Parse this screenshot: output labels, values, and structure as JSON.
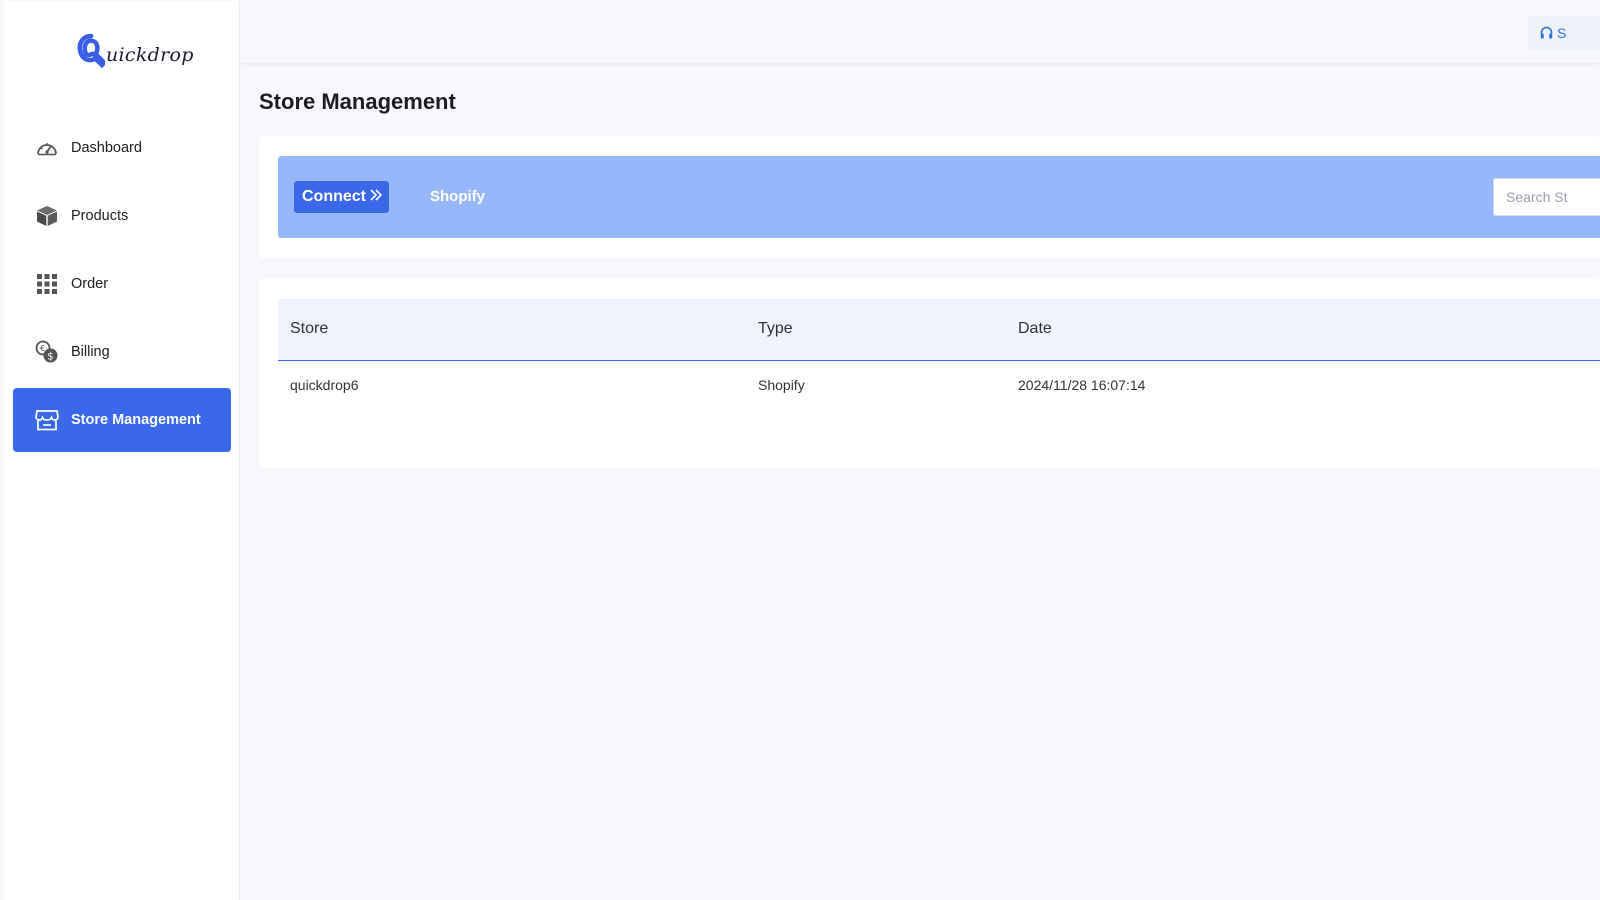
{
  "brand": {
    "logo_text": "uickdrop"
  },
  "sidebar": {
    "items": [
      {
        "label": "Dashboard",
        "icon": "dashboard-gauge-icon",
        "active": false
      },
      {
        "label": "Products",
        "icon": "box-icon",
        "active": false
      },
      {
        "label": "Order",
        "icon": "grid-icon",
        "active": false
      },
      {
        "label": "Billing",
        "icon": "coins-icon",
        "active": false
      },
      {
        "label": "Store Management",
        "icon": "store-icon",
        "active": true
      }
    ]
  },
  "header": {
    "support_label": "S",
    "support_icon": "headset-icon"
  },
  "page": {
    "title": "Store Management"
  },
  "connect_panel": {
    "connect_label": "Connect",
    "connect_icon": "double-chevron-right-icon",
    "platform_tab": "Shopify",
    "search_placeholder": "Search St"
  },
  "table": {
    "columns": [
      "Store",
      "Type",
      "Date"
    ],
    "rows": [
      {
        "store": "quickdrop6",
        "type": "Shopify",
        "date": "2024/11/28 16:07:14"
      }
    ]
  },
  "colors": {
    "accent": "#3b68e8",
    "banner": "#97b7fb",
    "table_header_bg": "#eef3fd"
  }
}
